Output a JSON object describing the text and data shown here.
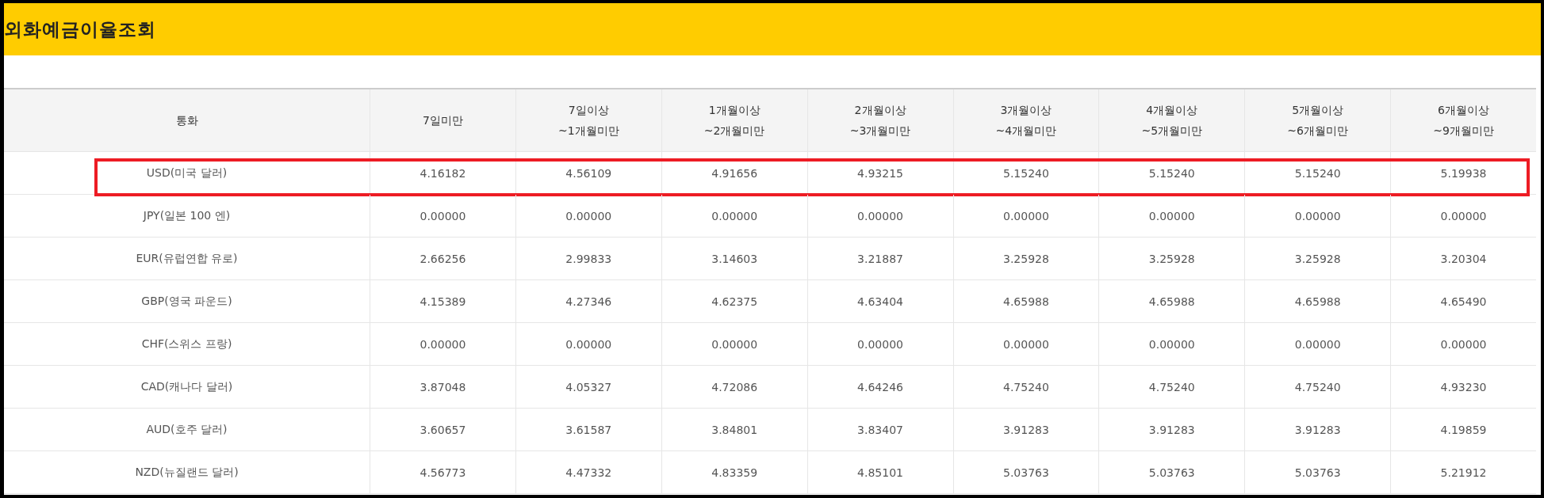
{
  "title": "외화예금이율조회",
  "table": {
    "columns": [
      "통화",
      "7일미만",
      "7일이상\n~1개월미만",
      "1개월이상\n~2개월미만",
      "2개월이상\n~3개월미만",
      "3개월이상\n~4개월미만",
      "4개월이상\n~5개월미만",
      "5개월이상\n~6개월미만",
      "6개월이상\n~9개월미만"
    ],
    "rows": [
      {
        "currency": "USD(미국 달러)",
        "highlighted": true,
        "values": [
          "4.16182",
          "4.56109",
          "4.91656",
          "4.93215",
          "5.15240",
          "5.15240",
          "5.15240",
          "5.19938"
        ]
      },
      {
        "currency": "JPY(일본 100 엔)",
        "highlighted": false,
        "values": [
          "0.00000",
          "0.00000",
          "0.00000",
          "0.00000",
          "0.00000",
          "0.00000",
          "0.00000",
          "0.00000"
        ]
      },
      {
        "currency": "EUR(유럽연합 유로)",
        "highlighted": false,
        "values": [
          "2.66256",
          "2.99833",
          "3.14603",
          "3.21887",
          "3.25928",
          "3.25928",
          "3.25928",
          "3.20304"
        ]
      },
      {
        "currency": "GBP(영국 파운드)",
        "highlighted": false,
        "values": [
          "4.15389",
          "4.27346",
          "4.62375",
          "4.63404",
          "4.65988",
          "4.65988",
          "4.65988",
          "4.65490"
        ]
      },
      {
        "currency": "CHF(스위스 프랑)",
        "highlighted": false,
        "values": [
          "0.00000",
          "0.00000",
          "0.00000",
          "0.00000",
          "0.00000",
          "0.00000",
          "0.00000",
          "0.00000"
        ]
      },
      {
        "currency": "CAD(캐나다 달러)",
        "highlighted": false,
        "values": [
          "3.87048",
          "4.05327",
          "4.72086",
          "4.64246",
          "4.75240",
          "4.75240",
          "4.75240",
          "4.93230"
        ]
      },
      {
        "currency": "AUD(호주 달러)",
        "highlighted": false,
        "values": [
          "3.60657",
          "3.61587",
          "3.84801",
          "3.83407",
          "3.91283",
          "3.91283",
          "3.91283",
          "4.19859"
        ]
      },
      {
        "currency": "NZD(뉴질랜드 달러)",
        "highlighted": false,
        "values": [
          "4.56773",
          "4.47332",
          "4.83359",
          "4.85101",
          "5.03763",
          "5.03763",
          "5.03763",
          "5.21912"
        ]
      }
    ]
  }
}
